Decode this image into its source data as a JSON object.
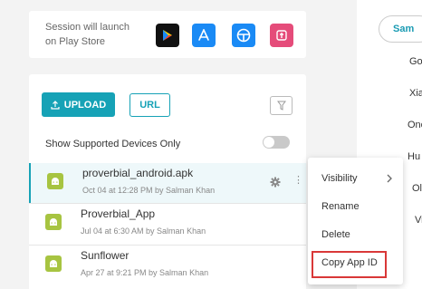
{
  "session": {
    "line1": "Session will launch",
    "line2": "on Play Store",
    "icons": [
      "google-play-icon",
      "app-store-icon",
      "tesla-icon",
      "huawei-appgallery-icon"
    ]
  },
  "right_panel": {
    "pill": "Sam",
    "labels": [
      "Go",
      "Xia",
      "One",
      "Hu",
      "Ol",
      "Vi"
    ]
  },
  "toolbar": {
    "upload_label": "UPLOAD",
    "url_label": "URL"
  },
  "filter_toggle_label": "Show Supported Devices Only",
  "apps": [
    {
      "name": "proverbial_android.apk",
      "meta": "Oct 04 at 12:28 PM by Salman Khan",
      "selected": true
    },
    {
      "name": "Proverbial_App",
      "meta": "Jul 04 at 6:30 AM by Salman Khan",
      "selected": false
    },
    {
      "name": "Sunflower",
      "meta": "Apr 27 at 9:21 PM by Salman Khan",
      "selected": false
    }
  ],
  "context_menu": {
    "items": [
      "Visibility",
      "Rename",
      "Delete",
      "Copy App ID"
    ],
    "highlighted": "Copy App ID"
  },
  "colors": {
    "accent": "#16a2b6",
    "android": "#a7c441",
    "highlight_border": "#d93838"
  }
}
